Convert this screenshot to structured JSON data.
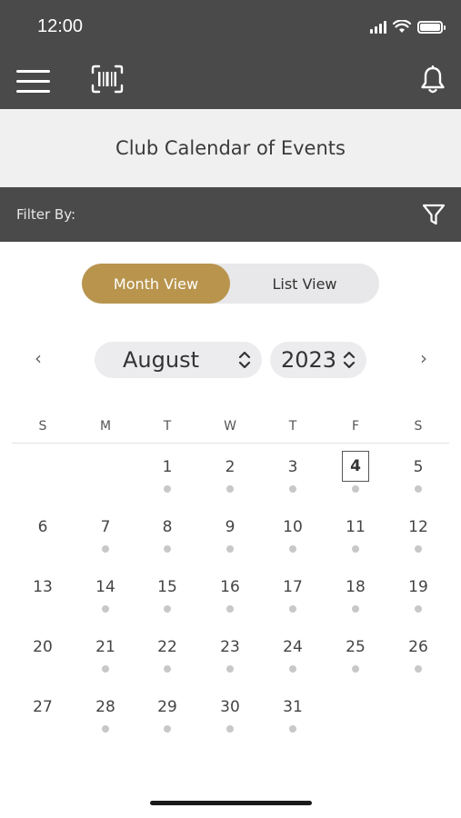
{
  "status_bar": {
    "time": "12:00"
  },
  "header": {
    "title": "Club Calendar of Events"
  },
  "filter": {
    "label": "Filter By:"
  },
  "view_toggle": {
    "month_view": "Month View",
    "list_view": "List View",
    "selected": "Month View"
  },
  "calendar": {
    "prev_arrow": "‹",
    "next_arrow": "›",
    "month": "August",
    "year": "2023",
    "weekdays": [
      "S",
      "M",
      "T",
      "W",
      "T",
      "F",
      "S"
    ],
    "today": 4,
    "weeks": [
      [
        "",
        "",
        "1",
        "2",
        "3",
        "4",
        "5"
      ],
      [
        "6",
        "7",
        "8",
        "9",
        "10",
        "11",
        "12"
      ],
      [
        "13",
        "14",
        "15",
        "16",
        "17",
        "18",
        "19"
      ],
      [
        "20",
        "21",
        "22",
        "23",
        "24",
        "25",
        "26"
      ],
      [
        "27",
        "28",
        "29",
        "30",
        "31",
        "",
        ""
      ]
    ],
    "days_with_events": [
      1,
      2,
      3,
      4,
      5,
      7,
      8,
      9,
      10,
      11,
      12,
      14,
      15,
      16,
      17,
      18,
      19,
      21,
      22,
      23,
      24,
      25,
      26,
      28,
      29,
      30,
      31
    ]
  },
  "colors": {
    "header_bg": "#4a4a4a",
    "accent": "#b8944d",
    "title_bg": "#f0f0f0",
    "event_dot": "#c8c8c8"
  }
}
